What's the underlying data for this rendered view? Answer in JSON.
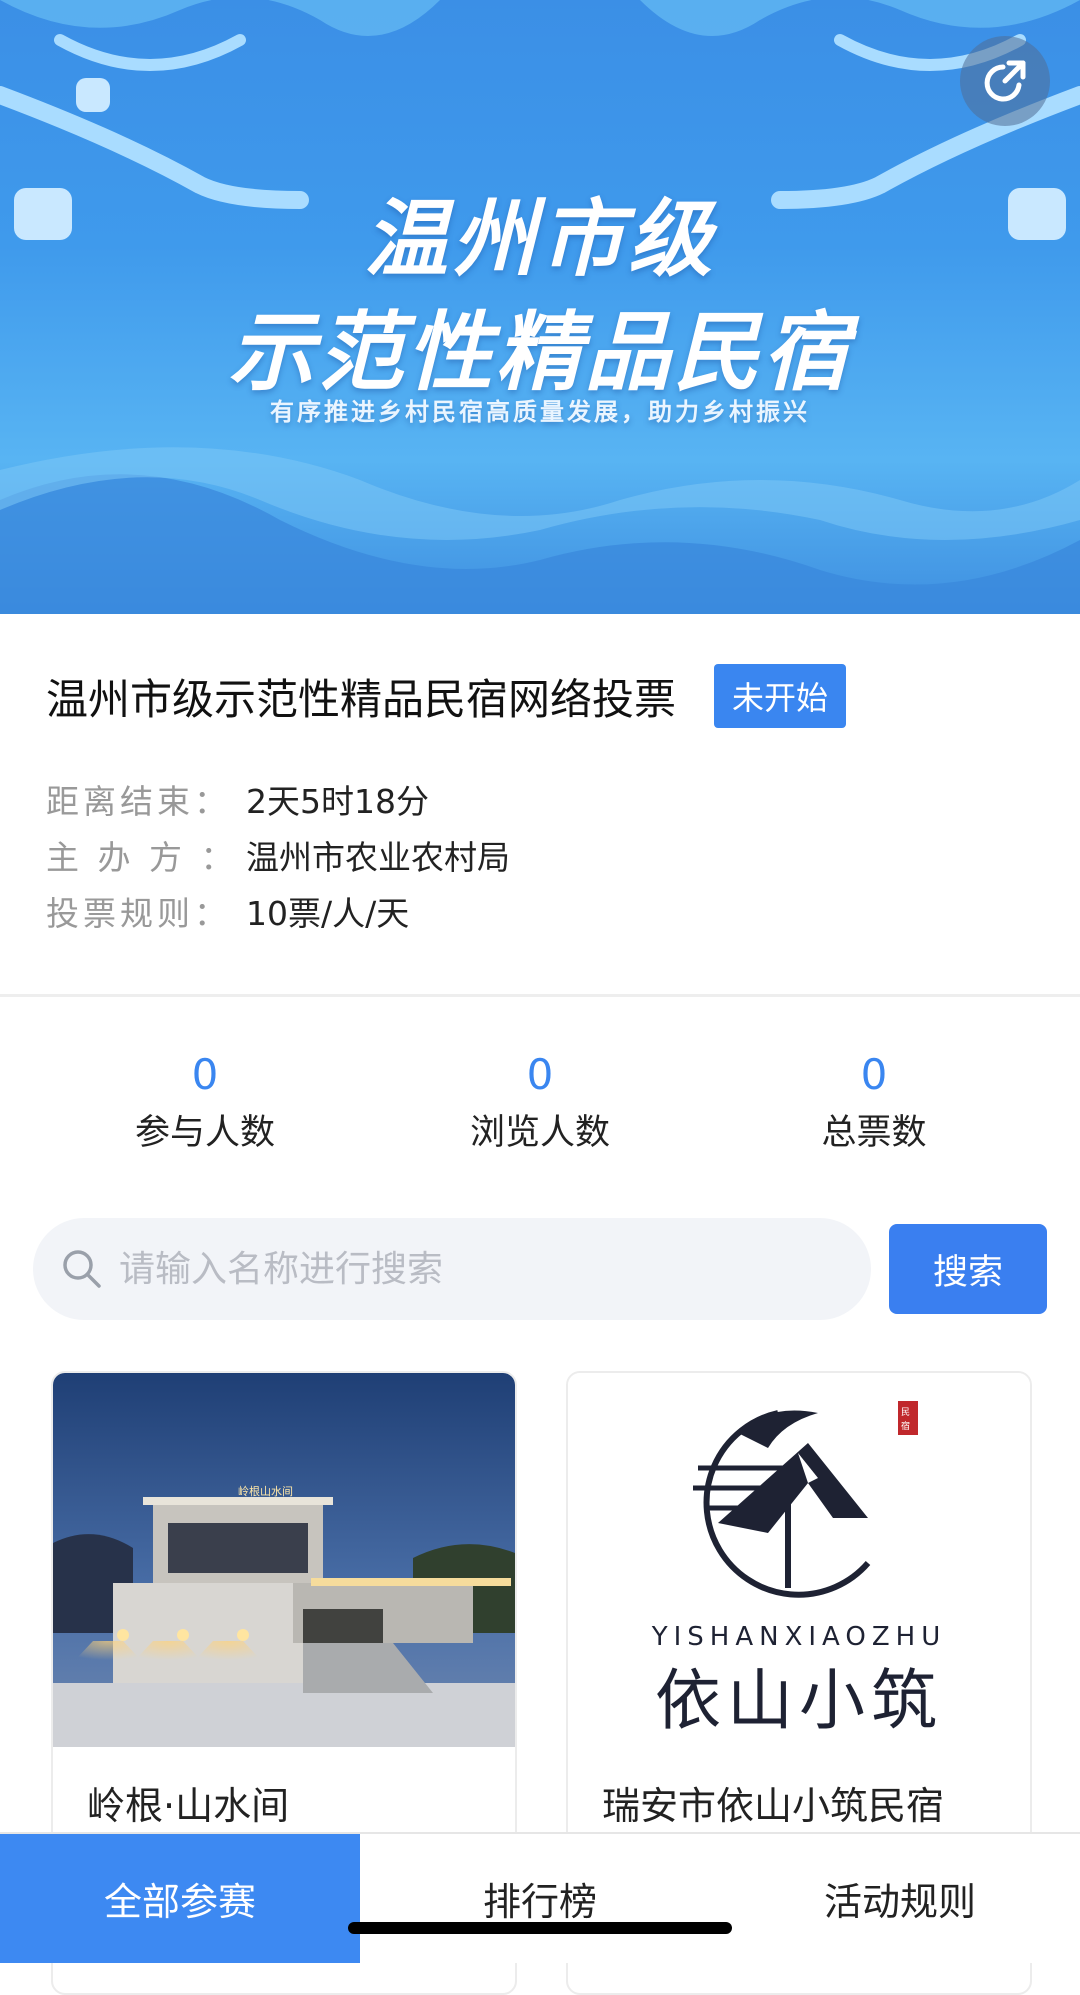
{
  "banner": {
    "line1": "温州市级",
    "line2": "示范性精品民宿",
    "slogan": "有序推进乡村民宿高质量发展，助力乡村振兴"
  },
  "activity": {
    "title": "温州市级示范性精品民宿网络投票",
    "status": "未开始",
    "meta": [
      {
        "label": "距离结束：",
        "value": "2天5时18分"
      },
      {
        "label": "主 办 方 ：",
        "value": "温州市农业农村局"
      },
      {
        "label": "投票规则：",
        "value": "10票/人/天"
      }
    ]
  },
  "stats": [
    {
      "value": "0",
      "label": "参与人数"
    },
    {
      "value": "0",
      "label": "浏览人数"
    },
    {
      "value": "0",
      "label": "总票数"
    }
  ],
  "search": {
    "placeholder": "请输入名称进行搜索",
    "button": "搜索"
  },
  "cards": [
    {
      "name": "岭根·山水间",
      "sign": "岭根山水间"
    },
    {
      "name": "瑞安市依山小筑民宿",
      "logo_pinyin": "YISHANXIAOZHU",
      "logo_cn": "依山小筑",
      "seal": "民宿"
    }
  ],
  "nav": [
    {
      "label": "全部参赛",
      "active": true
    },
    {
      "label": "排行榜",
      "active": false
    },
    {
      "label": "活动规则",
      "active": false
    }
  ],
  "colors": {
    "accent": "#3a86f0",
    "banner": "#3f9aec"
  }
}
